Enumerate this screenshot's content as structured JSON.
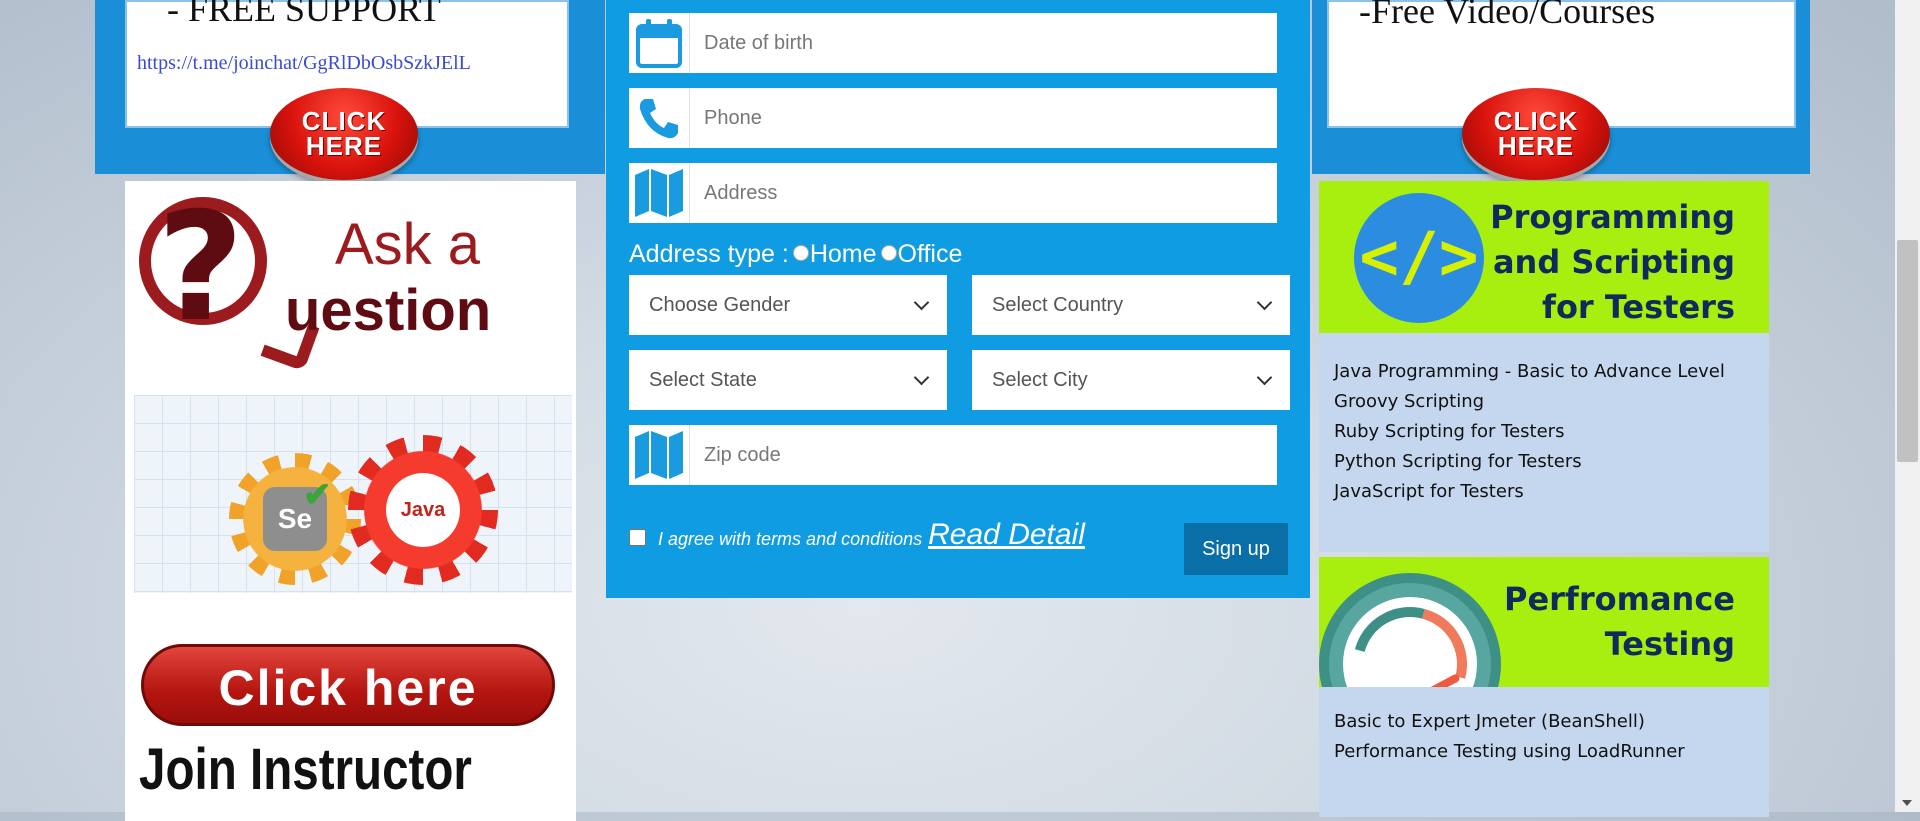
{
  "banners": {
    "left": {
      "support_text": "- FREE SUPPORT",
      "link": "https://t.me/joinchat/GgRlDbOsbSzkJElL",
      "button_label": "CLICK\nHERE"
    },
    "right": {
      "text": "-Free Video/Courses",
      "button_label": "CLICK\nHERE"
    }
  },
  "left_column": {
    "ask": {
      "line1": "Ask a",
      "line2": "uestion"
    },
    "gears": {
      "se_label": "Se",
      "java_label": "Java"
    },
    "click_here": "Click here",
    "join_instructor": "Join Instructor"
  },
  "form": {
    "fields": {
      "dob_placeholder": "Date of birth",
      "phone_placeholder": "Phone",
      "address_placeholder": "Address",
      "zip_placeholder": "Zip code"
    },
    "address_type": {
      "label": "Address type :",
      "options": [
        "Home",
        "Office"
      ]
    },
    "selects": {
      "gender": "Choose Gender",
      "country": "Select Country",
      "state": "Select State",
      "city": "Select City"
    },
    "terms_text": "I agree with terms and conditions",
    "read_detail": "Read Detail",
    "signup_label": "Sign up"
  },
  "right_column": {
    "programming": {
      "title": "Programming\nand Scripting\nfor Testers",
      "icon_text": "</>",
      "items": [
        "Java Programming - Basic to Advance Level",
        "Groovy Scripting",
        "Ruby Scripting for Testers",
        "Python Scripting for Testers",
        "JavaScript for Testers"
      ]
    },
    "performance": {
      "title": "Perfromance\nTesting",
      "gauge_min": "0",
      "gauge_max": "100",
      "items": [
        "Basic to Expert Jmeter (BeanShell)",
        "Performance Testing using LoadRunner"
      ]
    }
  },
  "colors": {
    "form_blue": "#0f9ce3",
    "signup_blue": "#0a6ea7",
    "course_green": "#a8ef10",
    "course_list_bg": "#c5d7ee"
  }
}
